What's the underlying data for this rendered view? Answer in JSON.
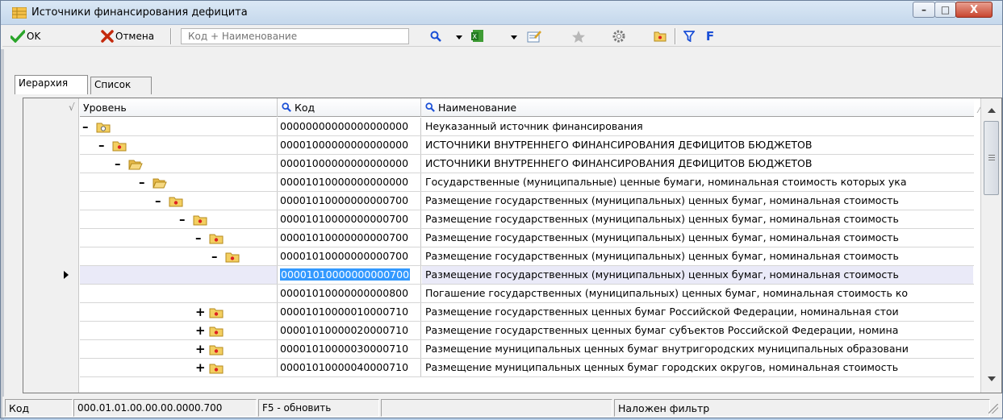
{
  "window": {
    "title": "Источники финансирования дефицита",
    "controls": {
      "minimize": "–",
      "maximize": "□",
      "close": "X"
    }
  },
  "toolbar": {
    "ok_label": "OK",
    "cancel_label": "Отмена",
    "search_placeholder": "Код + Наименование",
    "filter_letter": "F",
    "icons": [
      "search-icon",
      "dropdown-arrow",
      "excel-icon",
      "dropdown-arrow",
      "edit-icon",
      "star-icon",
      "gear-icon",
      "folder-icon",
      "filter-icon",
      "f-icon"
    ]
  },
  "tabs": [
    {
      "label": "Иерархия",
      "active": true
    },
    {
      "label": "Список",
      "active": false
    }
  ],
  "grid": {
    "columns": [
      "Уровень",
      "Код",
      "Наименование"
    ],
    "rows": [
      {
        "sign": "–",
        "icon": "star-folder",
        "code": "00000000000000000000",
        "name": "Неуказанный источник финансирования"
      },
      {
        "sign": "–",
        "icon": "folder-red",
        "code": "00001000000000000000",
        "name": "ИСТОЧНИКИ ВНУТРЕННЕГО ФИНАНСИРОВАНИЯ ДЕФИЦИТОВ БЮДЖЕТОВ"
      },
      {
        "sign": "–",
        "icon": "folder-open",
        "code": "00001000000000000000",
        "name": "ИСТОЧНИКИ ВНУТРЕННЕГО ФИНАНСИРОВАНИЯ ДЕФИЦИТОВ БЮДЖЕТОВ"
      },
      {
        "sign": "–",
        "icon": "folder-open",
        "code": "00001010000000000000",
        "name": "Государственные (муниципальные) ценные бумаги, номинальная стоимость которых ука"
      },
      {
        "sign": "–",
        "icon": "folder-red",
        "code": "00001010000000000700",
        "name": "Размещение государственных (муниципальных) ценных бумаг, номинальная стоимость"
      },
      {
        "sign": "–",
        "icon": "folder-red",
        "code": "00001010000000000700",
        "name": "Размещение государственных (муниципальных) ценных бумаг, номинальная стоимость"
      },
      {
        "sign": "–",
        "icon": "folder-red",
        "code": "00001010000000000700",
        "name": "Размещение государственных (муниципальных) ценных бумаг, номинальная стоимость"
      },
      {
        "sign": "–",
        "icon": "folder-red",
        "code": "00001010000000000700",
        "name": "Размещение государственных (муниципальных) ценных бумаг, номинальная стоимость"
      },
      {
        "sign": "•",
        "icon": "document",
        "code": "00001010000000000700",
        "name": "Размещение государственных (муниципальных) ценных бумаг, номинальная стоимость",
        "selected": true
      },
      {
        "sign": "•",
        "icon": "document",
        "code": "00001010000000000800",
        "name": "Погашение государственных (муниципальных) ценных бумаг, номинальная стоимость ко"
      },
      {
        "sign": "+",
        "icon": "folder-red",
        "code": "00001010000010000710",
        "name": "Размещение государственных ценных бумаг Российской Федерации, номинальная стои"
      },
      {
        "sign": "+",
        "icon": "folder-red",
        "code": "00001010000020000710",
        "name": "Размещение государственных ценных бумаг субъектов Российской Федерации, номина"
      },
      {
        "sign": "+",
        "icon": "folder-red",
        "code": "00001010000030000710",
        "name": "Размещение муниципальных ценных бумаг внутригородских муниципальных образовани"
      },
      {
        "sign": "+",
        "icon": "folder-red",
        "code": "00001010000040000710",
        "name": "Размещение муниципальных ценных бумаг городских округов, номинальная стоимость"
      }
    ]
  },
  "statusbar": {
    "field_label": "Код",
    "field_value": "000.01.01.00.00.00.0000.700",
    "refresh_hint": "F5 - обновить",
    "empty": "",
    "filter_status": "Наложен фильтр"
  },
  "colors": {
    "selection": "#3399ff",
    "tree_dot": "#1458d6",
    "ok_check": "#2aa52a",
    "cancel_x": "#c42a0d",
    "filter_f": "#1a4fd6"
  }
}
